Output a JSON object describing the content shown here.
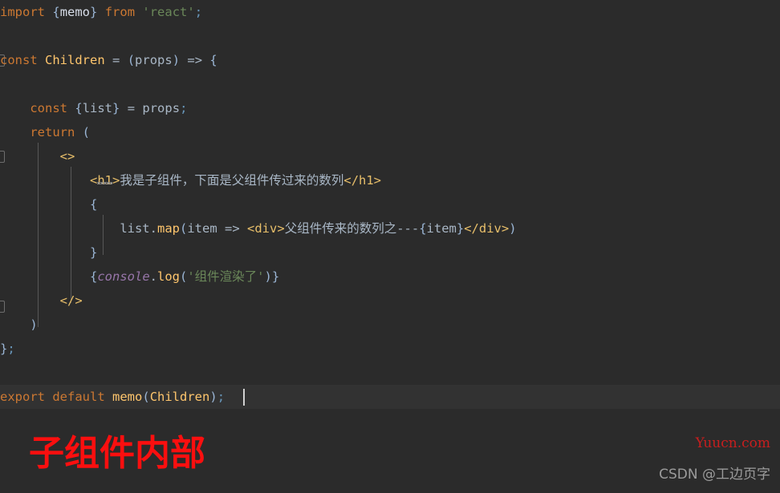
{
  "editor": {
    "theme": {
      "background": "#2b2b2b",
      "current_line_background": "#323232",
      "default_text": "#a9b7c6",
      "keyword": "#cc7832",
      "string": "#6a8759",
      "tag": "#e8bf6a",
      "function": "#ffc66d",
      "global": "#9876aa",
      "number_punct": "#6897bb"
    },
    "lines": [
      {
        "id": "line-import",
        "text": "import {memo} from 'react';",
        "tokens": [
          {
            "t": "import",
            "c": "kw"
          },
          {
            "t": " ",
            "c": "punc"
          },
          {
            "t": "{",
            "c": "brace"
          },
          {
            "t": "memo",
            "c": "white"
          },
          {
            "t": "}",
            "c": "brace"
          },
          {
            "t": " ",
            "c": "punc"
          },
          {
            "t": "from",
            "c": "kw"
          },
          {
            "t": " ",
            "c": "punc"
          },
          {
            "t": "'react'",
            "c": "str"
          },
          {
            "t": ";",
            "c": "semi"
          }
        ]
      },
      {
        "id": "line-blank-1",
        "text": "",
        "tokens": []
      },
      {
        "id": "line-const-children",
        "text": "const Children = (props) => {",
        "tokens": [
          {
            "t": "const",
            "c": "kw"
          },
          {
            "t": " ",
            "c": "punc"
          },
          {
            "t": "Children",
            "c": "cls"
          },
          {
            "t": " ",
            "c": "punc"
          },
          {
            "t": "=",
            "c": "punc"
          },
          {
            "t": " ",
            "c": "punc"
          },
          {
            "t": "(",
            "c": "brace"
          },
          {
            "t": "props",
            "c": "ident"
          },
          {
            "t": ")",
            "c": "brace"
          },
          {
            "t": " ",
            "c": "punc"
          },
          {
            "t": "=>",
            "c": "punc"
          },
          {
            "t": " ",
            "c": "punc"
          },
          {
            "t": "{",
            "c": "brace"
          }
        ]
      },
      {
        "id": "line-blank-2",
        "text": "",
        "tokens": []
      },
      {
        "id": "line-const-list",
        "text": "    const {list} = props;",
        "tokens": [
          {
            "t": "    ",
            "c": "punc"
          },
          {
            "t": "const",
            "c": "kw"
          },
          {
            "t": " ",
            "c": "punc"
          },
          {
            "t": "{",
            "c": "brace"
          },
          {
            "t": "list",
            "c": "ident"
          },
          {
            "t": "}",
            "c": "brace"
          },
          {
            "t": " ",
            "c": "punc"
          },
          {
            "t": "=",
            "c": "punc"
          },
          {
            "t": " ",
            "c": "punc"
          },
          {
            "t": "props",
            "c": "ident"
          },
          {
            "t": ";",
            "c": "semi"
          }
        ]
      },
      {
        "id": "line-return",
        "text": "    return (",
        "tokens": [
          {
            "t": "    ",
            "c": "punc"
          },
          {
            "t": "return",
            "c": "kw"
          },
          {
            "t": " ",
            "c": "punc"
          },
          {
            "t": "(",
            "c": "brace"
          }
        ]
      },
      {
        "id": "line-fragment-open",
        "text": "        <>",
        "tokens": [
          {
            "t": "        ",
            "c": "punc"
          },
          {
            "t": "<>",
            "c": "tag"
          }
        ]
      },
      {
        "id": "line-h1",
        "text": "            <h1>我是子组件，下面是父组件传过来的数列</h1>",
        "tokens": [
          {
            "t": "            ",
            "c": "punc"
          },
          {
            "t": "<",
            "c": "tag"
          },
          {
            "t": "h1",
            "c": "tag squiggle"
          },
          {
            "t": ">",
            "c": "tag"
          },
          {
            "t": "我是子组件，下面是父组件传过来的数列",
            "c": "text"
          },
          {
            "t": "</h1>",
            "c": "tag"
          }
        ]
      },
      {
        "id": "line-brace-open",
        "text": "            {",
        "tokens": [
          {
            "t": "            ",
            "c": "punc"
          },
          {
            "t": "{",
            "c": "brace"
          }
        ]
      },
      {
        "id": "line-map",
        "text": "                list.map(item => <div>父组件传来的数列之---{item}</div>)",
        "tokens": [
          {
            "t": "                ",
            "c": "punc"
          },
          {
            "t": "list",
            "c": "ident"
          },
          {
            "t": ".",
            "c": "punc"
          },
          {
            "t": "map",
            "c": "func"
          },
          {
            "t": "(",
            "c": "brace"
          },
          {
            "t": "item",
            "c": "ident"
          },
          {
            "t": " ",
            "c": "punc"
          },
          {
            "t": "=>",
            "c": "punc"
          },
          {
            "t": " ",
            "c": "punc"
          },
          {
            "t": "<div>",
            "c": "tag"
          },
          {
            "t": "父组件传来的数列之---",
            "c": "text"
          },
          {
            "t": "{",
            "c": "brace"
          },
          {
            "t": "item",
            "c": "ident"
          },
          {
            "t": "}",
            "c": "brace"
          },
          {
            "t": "</div>",
            "c": "tag"
          },
          {
            "t": ")",
            "c": "brace"
          }
        ]
      },
      {
        "id": "line-brace-close",
        "text": "            }",
        "tokens": [
          {
            "t": "            ",
            "c": "punc"
          },
          {
            "t": "}",
            "c": "brace"
          }
        ]
      },
      {
        "id": "line-console",
        "text": "            {console.log('组件渲染了')}",
        "tokens": [
          {
            "t": "            ",
            "c": "punc"
          },
          {
            "t": "{",
            "c": "brace"
          },
          {
            "t": "console",
            "c": "glob"
          },
          {
            "t": ".",
            "c": "punc"
          },
          {
            "t": "log",
            "c": "func"
          },
          {
            "t": "(",
            "c": "brace"
          },
          {
            "t": "'组件渲染了'",
            "c": "str"
          },
          {
            "t": ")",
            "c": "brace"
          },
          {
            "t": "}",
            "c": "brace"
          }
        ]
      },
      {
        "id": "line-fragment-close",
        "text": "        </>",
        "tokens": [
          {
            "t": "        ",
            "c": "punc"
          },
          {
            "t": "</>",
            "c": "tag"
          }
        ]
      },
      {
        "id": "line-paren-close",
        "text": "    )",
        "tokens": [
          {
            "t": "    ",
            "c": "punc"
          },
          {
            "t": ")",
            "c": "brace"
          }
        ]
      },
      {
        "id": "line-body-close",
        "text": "};",
        "tokens": [
          {
            "t": "}",
            "c": "brace"
          },
          {
            "t": ";",
            "c": "semi"
          }
        ]
      },
      {
        "id": "line-blank-3",
        "text": "",
        "tokens": []
      },
      {
        "id": "line-export",
        "text": "export default memo(Children);",
        "current": true,
        "tokens": [
          {
            "t": "export",
            "c": "kw"
          },
          {
            "t": " ",
            "c": "punc"
          },
          {
            "t": "default",
            "c": "kw"
          },
          {
            "t": " ",
            "c": "punc"
          },
          {
            "t": "memo",
            "c": "func"
          },
          {
            "t": "(",
            "c": "brace"
          },
          {
            "t": "Children",
            "c": "cls"
          },
          {
            "t": ")",
            "c": "brace"
          },
          {
            "t": ";",
            "c": "semi"
          }
        ]
      }
    ],
    "caret": {
      "line": 16,
      "column": 30
    }
  },
  "output": {
    "heading": "子组件内部",
    "heading_color": "#fb0f0f"
  },
  "watermark": {
    "site": "Yuucn.com",
    "user": "CSDN @工边页字"
  }
}
